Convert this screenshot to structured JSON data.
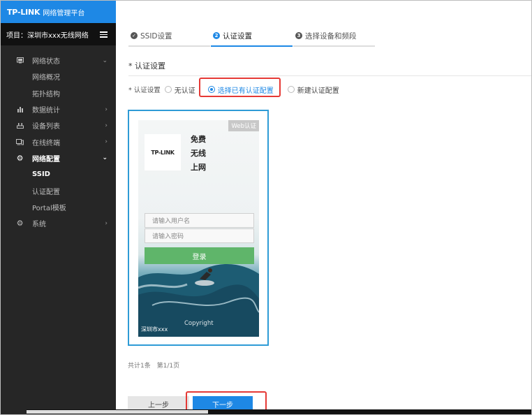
{
  "header": {
    "brand": "TP-LINK",
    "subtitle": "网络管理平台"
  },
  "project": {
    "label": "项目：深圳市xxx无线网络"
  },
  "sidebar": {
    "items": [
      {
        "label": "网络状态",
        "icon": "monitor-icon"
      },
      {
        "label": "数据统计",
        "icon": "bar-chart-icon"
      },
      {
        "label": "设备列表",
        "icon": "device-list-icon"
      },
      {
        "label": "在线终端",
        "icon": "terminal-icon"
      },
      {
        "label": "网络配置",
        "icon": "gear-icon"
      },
      {
        "label": "系统",
        "icon": "gear-icon"
      }
    ],
    "network_status_children": [
      "网络概况",
      "拓扑结构"
    ],
    "network_config_children": [
      "SSID",
      "认证配置",
      "Portal模板"
    ]
  },
  "tabs": [
    {
      "label": "SSID设置",
      "icon": "check-circle-icon"
    },
    {
      "label": "认证设置",
      "num": "2"
    },
    {
      "label": "选择设备和频段",
      "num": "3"
    }
  ],
  "section": {
    "title": "* 认证设置"
  },
  "auth": {
    "label": "* 认证设置",
    "options": [
      "无认证",
      "选择已有认证配置",
      "新建认证配置"
    ],
    "selected": "选择已有认证配置"
  },
  "preview": {
    "badge": "Web认证",
    "logo_text": "TP-LINK",
    "slogan": [
      "免费",
      "无线",
      "上网"
    ],
    "username_placeholder": "请输入用户名",
    "password_placeholder": "请输入密码",
    "login_label": "登录",
    "footer_left": "深圳市xxx",
    "footer_right": "Copyright"
  },
  "pagination": {
    "total": "共计1条",
    "page": "第1/1页"
  },
  "buttons": {
    "prev": "上一步",
    "next": "下一步"
  },
  "colors": {
    "accent": "#1e88e5",
    "sidebar": "#262626",
    "highlight": "#e53935",
    "login": "#5fb56a"
  }
}
